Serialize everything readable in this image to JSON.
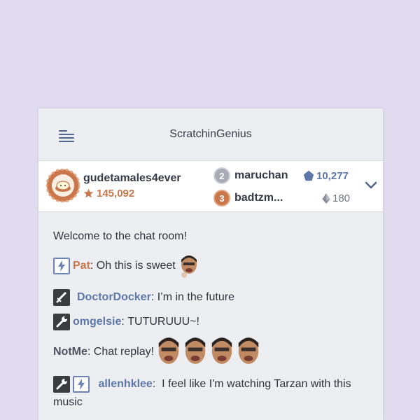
{
  "header": {
    "title": "ScratchinGenius"
  },
  "leaderboard": {
    "top": {
      "name": "gudetamales4ever",
      "score": "145,092"
    },
    "ranks": [
      {
        "rank": "2",
        "name": "maruchan",
        "stat": "10,277",
        "rank_color": "#a9aab5",
        "stat_color": "#5d77a8",
        "stat_icon": "pentagon-icon"
      },
      {
        "rank": "3",
        "name": "badtzm...",
        "stat": "180",
        "rank_color": "#c8764a",
        "stat_color": "#6f7382",
        "stat_icon": "gem-icon"
      }
    ]
  },
  "chat": {
    "welcome": "Welcome to the chat room!",
    "messages": [
      {
        "user": "Pat",
        "text": "Oh this is sweet",
        "user_color": "#c8764a"
      },
      {
        "user": "DoctorDocker",
        "text": "I’m in the future",
        "user_color": "#5d77a8"
      },
      {
        "user": "omgelsie",
        "text": "TUTURUUU~!",
        "user_color": "#5d77a8"
      },
      {
        "user": "NotMe",
        "text": "Chat replay!",
        "user_color": "#4e5260"
      },
      {
        "user": "allenhklee",
        "text": "I feel like I'm watching Tarzan with this music",
        "user_color": "#5d77a8"
      }
    ]
  }
}
